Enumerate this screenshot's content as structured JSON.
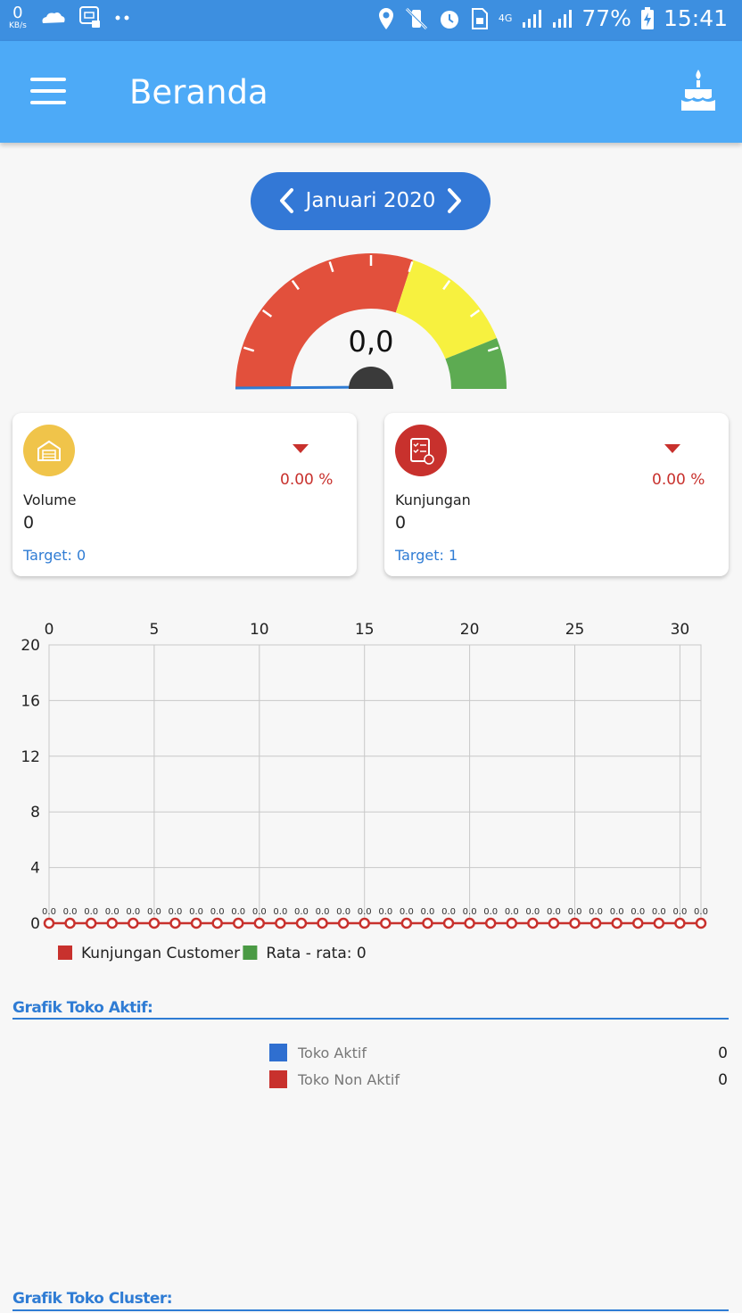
{
  "status_bar": {
    "speed_value": "0",
    "speed_unit": "KB/s",
    "network": "4G",
    "battery": "77%",
    "time": "15:41"
  },
  "app_bar": {
    "title": "Beranda"
  },
  "month_selector": {
    "label": "Januari 2020"
  },
  "gauge": {
    "value": "0,0",
    "needle_fraction": 0.0,
    "colors": {
      "red": "#e2503c",
      "yellow": "#f7f13f",
      "green": "#5dab52",
      "needle": "#2f7cd4",
      "hub": "#3a3a3a"
    }
  },
  "cards": [
    {
      "icon": "warehouse-icon",
      "icon_color": "#f0c44a",
      "trend": "down",
      "percent": "0.00 %",
      "label": "Volume",
      "value": "0",
      "target": "Target: 0"
    },
    {
      "icon": "checklist-icon",
      "icon_color": "#c8312d",
      "trend": "down",
      "percent": "0.00 %",
      "label": "Kunjungan",
      "value": "0",
      "target": "Target: 1"
    }
  ],
  "chart_data": {
    "type": "line",
    "x": [
      0,
      1,
      2,
      3,
      4,
      5,
      6,
      7,
      8,
      9,
      10,
      11,
      12,
      13,
      14,
      15,
      16,
      17,
      18,
      19,
      20,
      21,
      22,
      23,
      24,
      25,
      26,
      27,
      28,
      29,
      30,
      31
    ],
    "x_ticks": [
      "0",
      "5",
      "10",
      "15",
      "20",
      "25",
      "30"
    ],
    "y_ticks": [
      "0",
      "4",
      "8",
      "12",
      "16",
      "20"
    ],
    "xlim": [
      0,
      31
    ],
    "ylim": [
      0,
      20
    ],
    "series": [
      {
        "name": "Kunjungan Customer",
        "color": "#c8312d",
        "values": [
          0,
          0,
          0,
          0,
          0,
          0,
          0,
          0,
          0,
          0,
          0,
          0,
          0,
          0,
          0,
          0,
          0,
          0,
          0,
          0,
          0,
          0,
          0,
          0,
          0,
          0,
          0,
          0,
          0,
          0,
          0,
          0
        ]
      }
    ],
    "point_label": "0.0",
    "legend": [
      {
        "label": "Kunjungan Customer",
        "color": "#c8312d"
      },
      {
        "label": "Rata - rata: 0",
        "color": "#4a9a44"
      }
    ],
    "grid": true,
    "x_axis_position": "top",
    "legend_position": "bottom-left"
  },
  "toko_aktif": {
    "title": "Grafik Toko Aktif:",
    "items": [
      {
        "label": "Toko Aktif",
        "color": "#2f6fd0",
        "value": "0"
      },
      {
        "label": "Toko Non Aktif",
        "color": "#c8312d",
        "value": "0"
      }
    ]
  },
  "toko_cluster": {
    "title": "Grafik Toko Cluster:"
  }
}
